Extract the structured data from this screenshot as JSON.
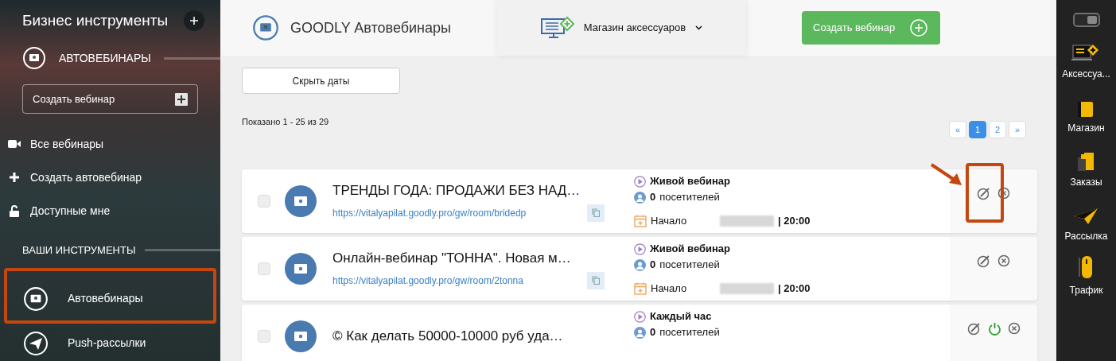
{
  "sidebar": {
    "title": "Бизнес инструменты",
    "section": "АВТОВЕБИНАРЫ",
    "create_button": "Создать вебинар",
    "menu": [
      {
        "label": "Все вебинары",
        "kind": "video"
      },
      {
        "label": "Создать автовебинар",
        "kind": "plus"
      },
      {
        "label": "Доступные мне",
        "kind": "lock"
      }
    ],
    "tools_heading": "ВАШИ ИНСТРУМЕНТЫ",
    "tools": [
      {
        "label": "Автовебинары",
        "kind": "webinar",
        "highlighted": true
      },
      {
        "label": "Push-рассылки",
        "kind": "send",
        "highlighted": false
      }
    ]
  },
  "header": {
    "title": "GOODLY Автовебинары",
    "store": "Магазин аксессуаров",
    "create_button": "Создать вебинар"
  },
  "hide_dates_button": "Скрыть даты",
  "shown": "Показано 1 - 25 из 29",
  "pagination": [
    {
      "label": "«",
      "selected": false
    },
    {
      "label": "1",
      "selected": true
    },
    {
      "label": "2",
      "selected": false
    },
    {
      "label": "»",
      "selected": false
    }
  ],
  "webinars": [
    {
      "title": "ТРЕНДЫ ГОДА: ПРОДАЖИ БЕЗ НАД…",
      "url": "https://vitalyapilat.goodly.pro/gw/room/bridedp",
      "type": "Живой вебинар",
      "visitors_count": "0",
      "visitors_label": "посетителей",
      "start_label": "Начало",
      "time": "| 20:00",
      "checked": false,
      "actions": [
        {
          "kind": "edit"
        },
        {
          "kind": "delete"
        }
      ],
      "highlighted": true
    },
    {
      "title": "Онлайн-вебинар \"ТОННА\". Новая м…",
      "url": "https://vitalyapilat.goodly.pro/gw/room/2tonna",
      "type": "Живой вебинар",
      "visitors_count": "0",
      "visitors_label": "посетителей",
      "start_label": "Начало",
      "time": "| 20:00",
      "checked": false,
      "actions": [
        {
          "kind": "edit"
        },
        {
          "kind": "delete"
        }
      ],
      "highlighted": false
    },
    {
      "title": "©  Как делать 50000-10000 руб уда…",
      "type": "Каждый час",
      "visitors_count": "0",
      "visitors_label": "посетителей",
      "checked": false,
      "actions": [
        {
          "kind": "edit"
        },
        {
          "kind": "power"
        },
        {
          "kind": "delete"
        }
      ],
      "highlighted": false
    }
  ],
  "right_bar": [
    {
      "label": "Аксессуа...",
      "kind": "accessories"
    },
    {
      "label": "Магазин",
      "kind": "shop"
    },
    {
      "label": "Заказы",
      "kind": "orders"
    },
    {
      "label": "Рассылка",
      "kind": "mail"
    },
    {
      "label": "Трафик",
      "kind": "traffic"
    }
  ]
}
